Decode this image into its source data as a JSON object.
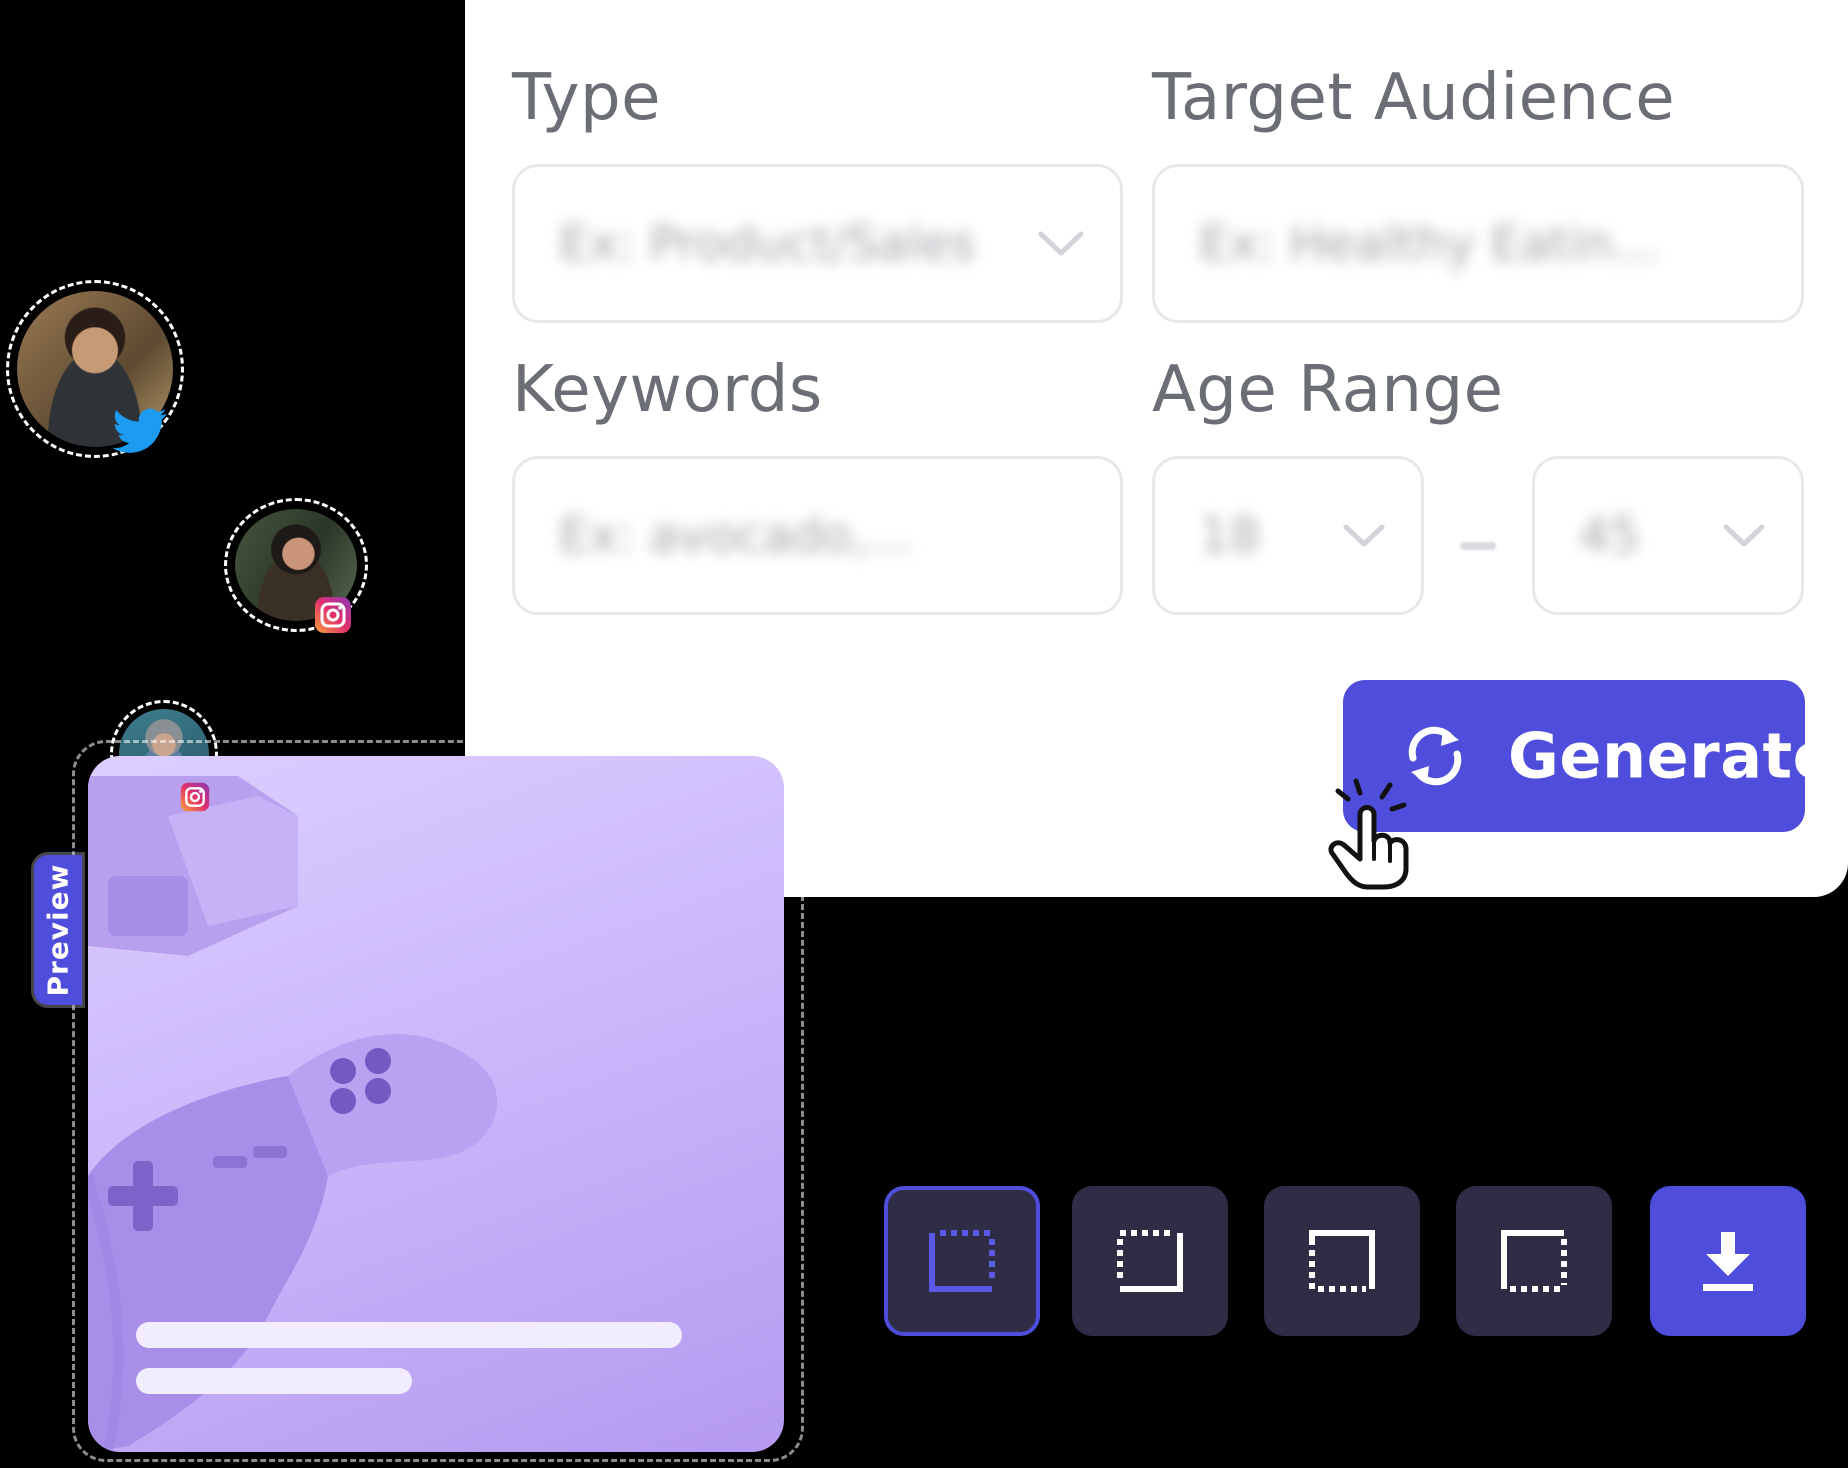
{
  "form": {
    "type_label": "Type",
    "type_value": "Ex: Product/Sales",
    "audience_label": "Target Audience",
    "audience_value": "Ex: Healthy Eatin...",
    "keywords_label": "Keywords",
    "keywords_value": "Ex: avocado,...",
    "age_label": "Age Range",
    "age_min": "18",
    "age_max": "45",
    "generate_label": "Generate"
  },
  "preview": {
    "tab_label": "Preview"
  },
  "social_badges": [
    "twitter-icon",
    "instagram-icon",
    "instagram-icon"
  ],
  "toolbar": {
    "tools": [
      "frame-bottom-left-icon",
      "frame-bottom-right-icon",
      "frame-top-left-icon",
      "frame-top-right-icon",
      "download-icon"
    ]
  },
  "colors": {
    "accent": "#4f4ddb",
    "tool_bg": "#2e2d45",
    "label": "#6b6e74",
    "field_border": "#e7e8ec",
    "twitter": "#1d9bf0"
  }
}
